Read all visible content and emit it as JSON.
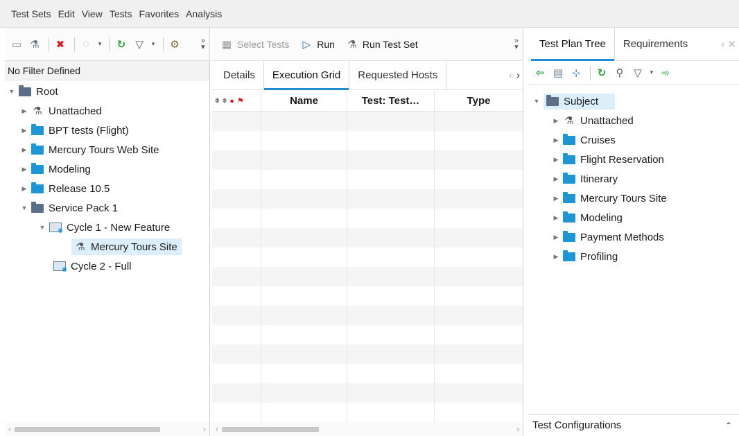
{
  "menu": [
    "Test Sets",
    "Edit",
    "View",
    "Tests",
    "Favorites",
    "Analysis"
  ],
  "left": {
    "filter_text": "No Filter Defined",
    "tree": {
      "root": "Root",
      "children": [
        "Unattached",
        "BPT tests (Flight)",
        "Mercury Tours Web Site",
        "Modeling",
        "Release 10.5"
      ],
      "service_pack": "Service Pack 1",
      "cycle1": "Cycle 1 - New Feature",
      "cycle1_child": "Mercury Tours Site",
      "cycle2": "Cycle 2 - Full"
    }
  },
  "mid": {
    "toolbar": {
      "select_tests": "Select Tests",
      "run": "Run",
      "run_test_set": "Run Test Set"
    },
    "tabs": [
      "Details",
      "Execution Grid",
      "Requested Hosts"
    ],
    "active_tab": "Execution Grid",
    "columns": [
      "Name",
      "Test: Test…",
      "Type"
    ]
  },
  "right": {
    "tabs": [
      "Test Plan Tree",
      "Requirements"
    ],
    "tree": {
      "root": "Subject",
      "children": [
        "Unattached",
        "Cruises",
        "Flight Reservation",
        "Itinerary",
        "Mercury Tours Site",
        "Modeling",
        "Payment Methods",
        "Profiling"
      ]
    },
    "bottom_label": "Test Configurations"
  },
  "colors": {
    "accent": "#1e8dd6",
    "folder": "#1e95d4",
    "selection": "#dceefa"
  }
}
